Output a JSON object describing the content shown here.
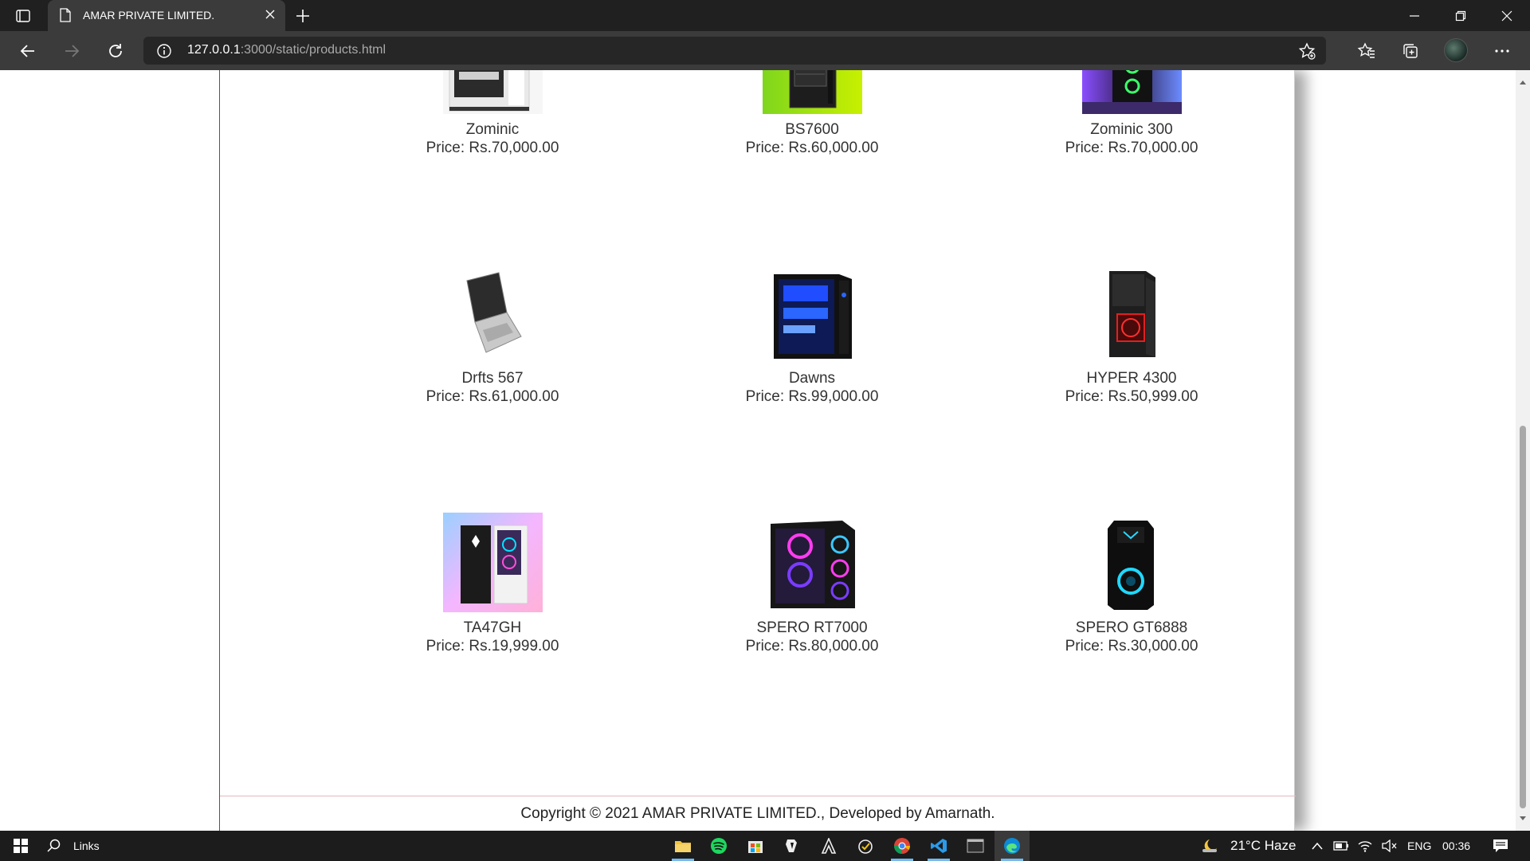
{
  "browser": {
    "tab_title": "AMAR PRIVATE LIMITED.",
    "url_host": "127.0.0.1",
    "url_rest": ":3000/static/products.html"
  },
  "products": [
    {
      "name": "Zominic",
      "price": "Price: Rs.70,000.00",
      "image": "white-pc-case"
    },
    {
      "name": "BS7600",
      "price": "Price: Rs.60,000.00",
      "image": "black-case-green-bg"
    },
    {
      "name": "Zominic 300",
      "price": "Price: Rs.70,000.00",
      "image": "rgb-case-purple"
    },
    {
      "name": "Drfts 567",
      "price": "Price: Rs.61,000.00",
      "image": "silver-laptop"
    },
    {
      "name": "Dawns",
      "price": "Price: Rs.99,000.00",
      "image": "blue-glass-case"
    },
    {
      "name": "HYPER 4300",
      "price": "Price: Rs.50,999.00",
      "image": "red-black-case"
    },
    {
      "name": "TA47GH",
      "price": "Price: Rs.19,999.00",
      "image": "omen-pc-pastel"
    },
    {
      "name": "SPERO RT7000",
      "price": "Price: Rs.80,000.00",
      "image": "rgb-fan-case"
    },
    {
      "name": "SPERO GT6888",
      "price": "Price: Rs.30,000.00",
      "image": "predator-tower"
    }
  ],
  "footer": {
    "text": "Copyright © 2021 AMAR PRIVATE LIMITED., Developed by Amarnath."
  },
  "taskbar": {
    "search_label": "Links",
    "weather": "21°C  Haze",
    "language": "ENG",
    "time": "00:36"
  }
}
